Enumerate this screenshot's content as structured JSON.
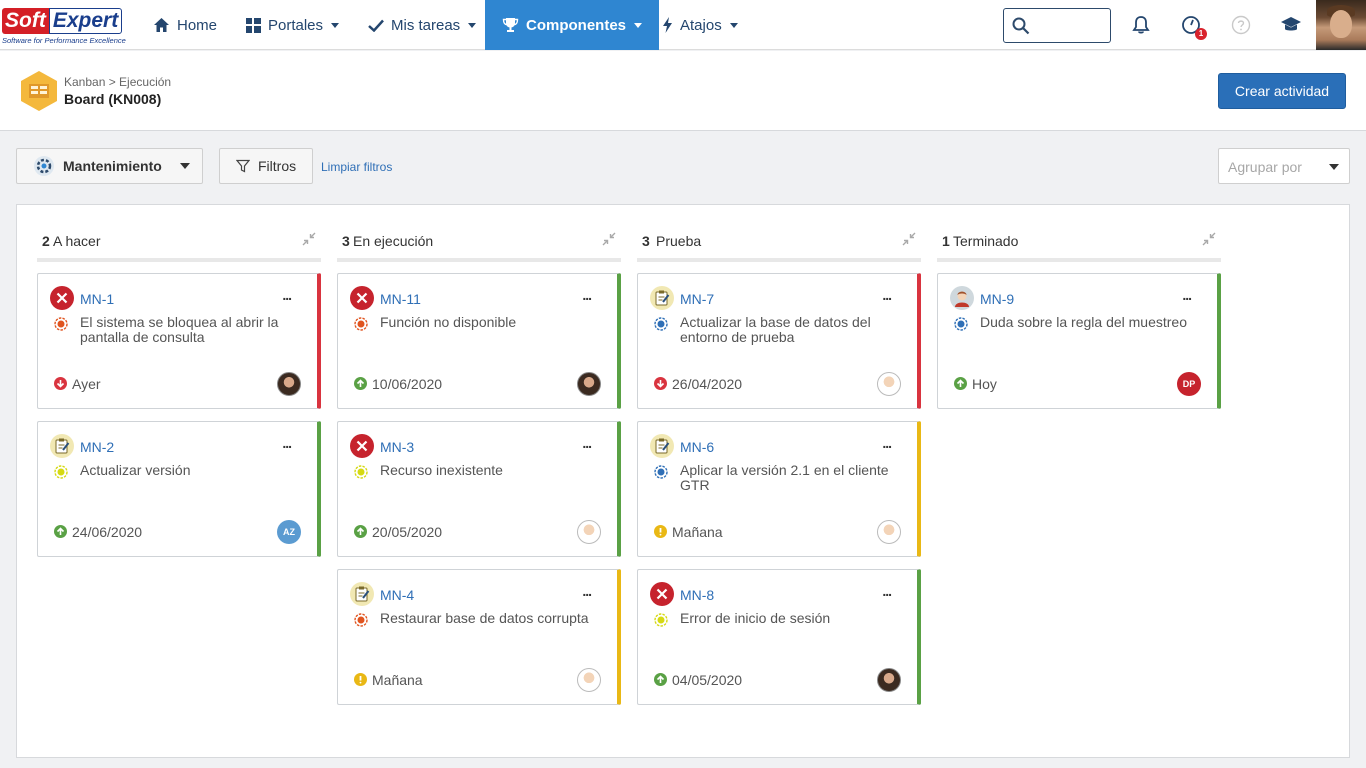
{
  "nav": {
    "logo_soft": "Soft",
    "logo_expert": "Expert",
    "logo_tagline": "Software for Performance Excellence",
    "home": "Home",
    "portales": "Portales",
    "mis_tareas": "Mis tareas",
    "componentes": "Componentes",
    "atajos": "Atajos",
    "search_placeholder": "",
    "help_badge": "1"
  },
  "header": {
    "breadcrumb": "Kanban > Ejecución",
    "title": "Board (KN008)",
    "create_button": "Crear actividad"
  },
  "filters": {
    "process": "Mantenimiento",
    "filters_button": "Filtros",
    "clear_link": "Limpiar filtros",
    "group_placeholder": "Agrupar por"
  },
  "columns": [
    {
      "count": "2",
      "name": "A hacer"
    },
    {
      "count": "3",
      "name": "En ejecución"
    },
    {
      "count": "3",
      "name": "Prueba"
    },
    {
      "count": "1",
      "name": "Terminado"
    }
  ],
  "cards": [
    {
      "key": "MN-1",
      "title": "El sistema se bloquea al abrir la pantalla de consulta",
      "due": "Ayer",
      "more": "...",
      "type": "error",
      "priority": "orange",
      "due_status": "down",
      "avatar": "photo",
      "avatar_text": "",
      "accent": "#d9343f"
    },
    {
      "key": "MN-2",
      "title": "Actualizar versión",
      "due": "24/06/2020",
      "more": "...",
      "type": "task",
      "priority": "yellow",
      "due_status": "up",
      "avatar": "initials",
      "avatar_text": "AZ",
      "accent": "#5aa145"
    },
    {
      "key": "MN-11",
      "title": "Función no disponible",
      "due": "10/06/2020",
      "more": "...",
      "type": "error",
      "priority": "orange",
      "due_status": "up",
      "avatar": "photo",
      "avatar_text": "",
      "accent": "#5aa145"
    },
    {
      "key": "MN-3",
      "title": "Recurso inexistente",
      "due": "20/05/2020",
      "more": "...",
      "type": "error",
      "priority": "yellow",
      "due_status": "up",
      "avatar": "cartoon",
      "avatar_text": "",
      "accent": "#5aa145"
    },
    {
      "key": "MN-4",
      "title": "Restaurar base de datos corrupta",
      "due": "Mañana",
      "more": "...",
      "type": "task",
      "priority": "orange",
      "due_status": "warn",
      "avatar": "cartoon",
      "avatar_text": "",
      "accent": "#e9b815"
    },
    {
      "key": "MN-7",
      "title": "Actualizar la base de datos del entorno de prueba",
      "due": "26/04/2020",
      "more": "...",
      "type": "task",
      "priority": "blue",
      "due_status": "down",
      "avatar": "cartoon",
      "avatar_text": "",
      "accent": "#d9343f"
    },
    {
      "key": "MN-6",
      "title": "Aplicar la versión 2.1 en el cliente GTR",
      "due": "Mañana",
      "more": "...",
      "type": "task",
      "priority": "blue",
      "due_status": "warn",
      "avatar": "cartoon",
      "avatar_text": "",
      "accent": "#e9b815"
    },
    {
      "key": "MN-8",
      "title": "Error de inicio de sesión",
      "due": "04/05/2020",
      "more": "...",
      "type": "error",
      "priority": "yellow",
      "due_status": "up",
      "avatar": "photo",
      "avatar_text": "",
      "accent": "#5aa145"
    },
    {
      "key": "MN-9",
      "title": "Duda sobre la regla del muestreo",
      "due": "Hoy",
      "more": "...",
      "type": "user",
      "priority": "blue",
      "due_status": "up",
      "avatar": "initials-red",
      "avatar_text": "DP",
      "accent": "#5aa145"
    }
  ]
}
